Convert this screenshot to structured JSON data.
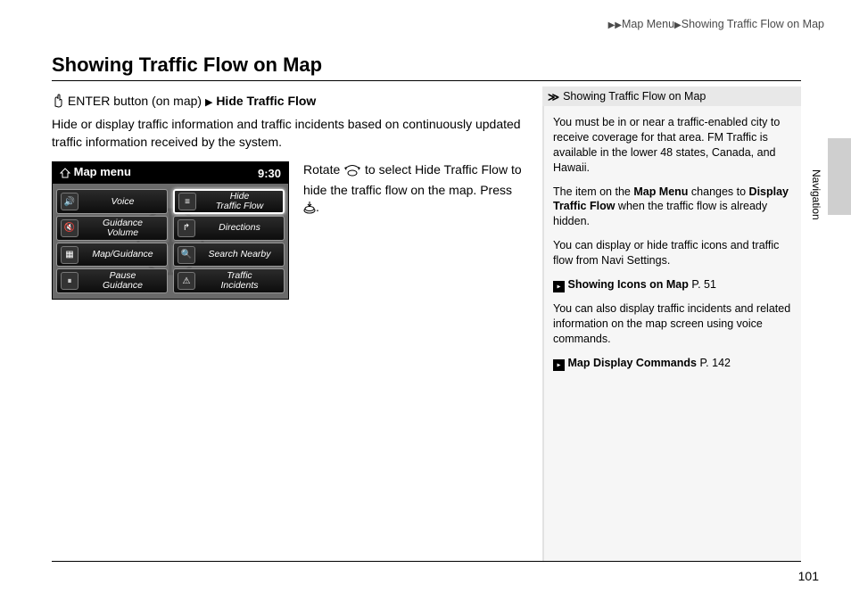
{
  "breadcrumb": {
    "part1": "Map Menu",
    "part2": "Showing Traffic Flow on Map"
  },
  "title": "Showing Traffic Flow on Map",
  "path": {
    "before": " ENTER button (on map) ",
    "target": "Hide Traffic Flow"
  },
  "description": "Hide or display traffic information and traffic incidents based on continuously updated traffic information received by the system.",
  "screen": {
    "header": "Map menu",
    "clock": "9:30",
    "buttons": {
      "b1": "Voice",
      "b2_l1": "Hide",
      "b2_l2": "Traffic Flow",
      "b3_l1": "Guidance",
      "b3_l2": "Volume",
      "b4": "Directions",
      "b5": "Map/Guidance",
      "b6": "Search Nearby",
      "b7_l1": "Pause",
      "b7_l2": "Guidance",
      "b8_l1": "Traffic",
      "b8_l2": "Incidents"
    }
  },
  "instruction": {
    "p1": "Rotate ",
    "p2": " to select ",
    "target": "Hide Traffic Flow",
    "p3": " to hide the traffic flow on the map. Press ",
    "p4": "."
  },
  "sidebar": {
    "header": "Showing Traffic Flow on Map",
    "para1": "You must be in or near a traffic-enabled city to receive coverage for that area. FM Traffic is available in the lower 48 states, Canada, and Hawaii.",
    "para2a": "The item on the ",
    "para2b": "Map Menu",
    "para2c": " changes to ",
    "para2d": "Display Traffic Flow",
    "para2e": " when the traffic flow is already hidden.",
    "para3": "You can display or hide traffic icons and traffic flow from Navi Settings.",
    "ref1": "Showing Icons on Map",
    "ref1p": " P. 51",
    "para4": "You can also display traffic incidents and related information on the map screen using voice commands.",
    "ref2": "Map Display Commands",
    "ref2p": " P. 142"
  },
  "sideLabel": "Navigation",
  "pageNum": "101"
}
